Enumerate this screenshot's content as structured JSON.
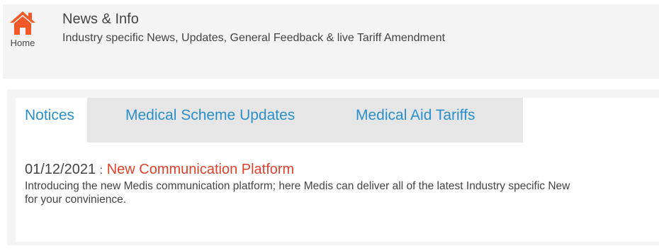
{
  "header": {
    "home_label": "Home",
    "title": "News & Info",
    "subtitle": "Industry specific News, Updates, General Feedback & live Tariff Amendment"
  },
  "tabs": [
    {
      "label": "Notices",
      "active": true
    },
    {
      "label": "Medical Scheme Updates",
      "active": false
    },
    {
      "label": "Medical Aid Tariffs",
      "active": false
    }
  ],
  "notice": {
    "date": "01/12/2021",
    "separator": ":",
    "title": "New Communication Platform",
    "body_line1": "Introducing the new Medis communication platform; here Medis can deliver all of the latest Industry specific New",
    "body_line2": "for your convinience."
  },
  "colors": {
    "accent": "#2b8fc9",
    "notice_title": "#e0412b",
    "home_icon": "#f05a28"
  },
  "icons": {
    "home": "home-icon"
  }
}
